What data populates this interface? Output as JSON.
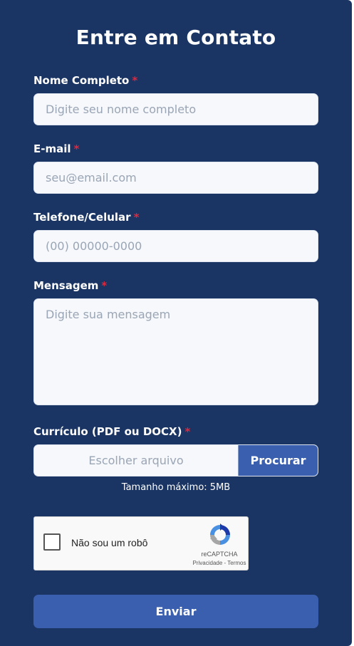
{
  "form": {
    "title": "Entre em Contato",
    "required_marker": "*",
    "name": {
      "label": "Nome Completo",
      "placeholder": "Digite seu nome completo",
      "value": ""
    },
    "email": {
      "label": "E-mail",
      "placeholder": "seu@email.com",
      "value": ""
    },
    "phone": {
      "label": "Telefone/Celular",
      "placeholder": "(00) 00000-0000",
      "value": ""
    },
    "message": {
      "label": "Mensagem",
      "placeholder": "Digite sua mensagem",
      "value": ""
    },
    "resume": {
      "label": "Currículo (PDF ou DOCX)",
      "file_placeholder": "Escolher arquivo",
      "browse_label": "Procurar",
      "max_size_note": "Tamanho máximo: 5MB"
    },
    "recaptcha": {
      "checkbox_label": "Não sou um robô",
      "brand": "reCAPTCHA",
      "privacy": "Privacidade",
      "separator": " - ",
      "terms": "Termos",
      "checked": false
    },
    "submit_label": "Enviar"
  },
  "colors": {
    "background": "#1a3563",
    "accent": "#3a5fae",
    "required": "#e0283c",
    "input_bg": "#f6f8fb"
  }
}
